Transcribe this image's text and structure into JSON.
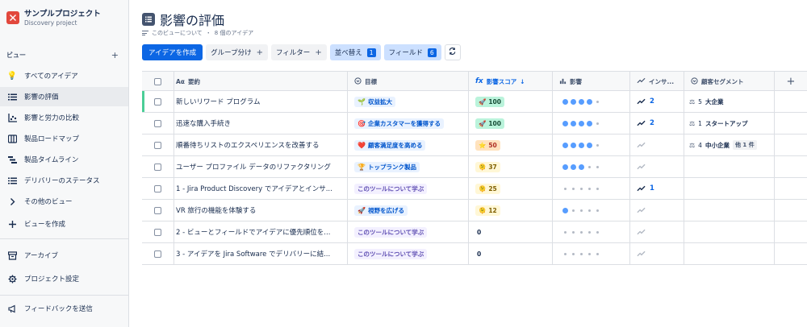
{
  "project": {
    "name": "サンプルプロジェクト",
    "subtitle": "Discovery project"
  },
  "sidebar": {
    "views_label": "ビュー",
    "items": [
      {
        "label": "すべてのアイデア",
        "icon": "lightbulb-icon"
      },
      {
        "label": "影響の評価",
        "icon": "list-icon",
        "active": true
      },
      {
        "label": "影響と労力の比較",
        "icon": "scatter-chart-icon"
      },
      {
        "label": "製品ロードマップ",
        "icon": "board-icon"
      },
      {
        "label": "製品タイムライン",
        "icon": "timeline-icon"
      },
      {
        "label": "デリバリーのステータス",
        "icon": "list-icon"
      },
      {
        "label": "その他のビュー",
        "icon": "chevron-right-icon"
      },
      {
        "label": "ビューを作成",
        "icon": "plus-icon"
      }
    ],
    "archive_label": "アーカイブ",
    "settings_label": "プロジェクト設定",
    "feedback_label": "フィードバックを送信"
  },
  "header": {
    "title": "影響の評価",
    "about": "このビューについて",
    "count": "8 個のアイデア",
    "separator": "・"
  },
  "toolbar": {
    "create_label": "アイデアを作成",
    "group_label": "グループ分け",
    "filter_label": "フィルター",
    "sort_label": "並べ替え",
    "sort_count": "1",
    "fields_label": "フィールド",
    "fields_count": "6"
  },
  "table": {
    "columns": {
      "summary": "要約",
      "summary_icon": "Aα",
      "goal": "目標",
      "score": "影響スコア",
      "score_icon": "fx",
      "impact": "影響",
      "insights": "インサ...",
      "segment": "顧客セグメント"
    },
    "rows": [
      {
        "summary": "新しいリワード プログラム",
        "goal": "収益拡大",
        "goal_emoji": "🌱",
        "goal_style": "goal",
        "score": "100",
        "score_emoji": "🚀",
        "score_style": "green",
        "impact": 4,
        "insights": "2",
        "segment_count": "5",
        "segment": "大企業",
        "segment_more": "",
        "highlight": true
      },
      {
        "summary": "迅速な購入手続き",
        "goal": "企業カスタマーを獲得する",
        "goal_emoji": "🎯",
        "goal_style": "goal",
        "score": "100",
        "score_emoji": "🚀",
        "score_style": "green",
        "impact": 4,
        "insights": "2",
        "segment_count": "1",
        "segment": "スタートアップ",
        "segment_more": "",
        "highlight": false
      },
      {
        "summary": "順番待ちリストのエクスペリエンスを改善する",
        "goal": "顧客満足度を高める",
        "goal_emoji": "❤️",
        "goal_style": "goal",
        "score": "50",
        "score_emoji": "⭐",
        "score_style": "red",
        "impact": 4,
        "insights": "",
        "segment_count": "4",
        "segment": "中小企業",
        "segment_more": "他 1 件",
        "highlight": false
      },
      {
        "summary": "ユーザー プロファイル データのリファクタリング",
        "goal": "トップランク製品",
        "goal_emoji": "🏆",
        "goal_style": "goal",
        "score": "37",
        "score_emoji": "🫠",
        "score_style": "amber",
        "impact": 3,
        "insights": "",
        "segment_count": "",
        "segment": "",
        "segment_more": "",
        "highlight": false
      },
      {
        "summary": "1 - Jira Product Discovery でアイデアとインサ...",
        "goal": "このツールについて学ぶ",
        "goal_emoji": "",
        "goal_style": "learn",
        "score": "25",
        "score_emoji": "🫠",
        "score_style": "amber",
        "impact": 0,
        "insights": "1",
        "segment_count": "",
        "segment": "",
        "segment_more": "",
        "highlight": false
      },
      {
        "summary": "VR 旅行の機能を体験する",
        "goal": "視野を広げる",
        "goal_emoji": "🚀",
        "goal_style": "goal",
        "score": "12",
        "score_emoji": "🫠",
        "score_style": "amber",
        "impact": 1,
        "insights": "",
        "segment_count": "",
        "segment": "",
        "segment_more": "",
        "highlight": false
      },
      {
        "summary": "2 - ビューとフィールドでアイデアに優先順位を...",
        "goal": "このツールについて学ぶ",
        "goal_emoji": "",
        "goal_style": "learn",
        "score": "0",
        "score_emoji": "",
        "score_style": "plain",
        "impact": -1,
        "insights": "",
        "segment_count": "",
        "segment": "",
        "segment_more": "",
        "highlight": false
      },
      {
        "summary": "3 - アイデアを Jira Software でデリバリーに結...",
        "goal": "このツールについて学ぶ",
        "goal_emoji": "",
        "goal_style": "learn",
        "score": "0",
        "score_emoji": "",
        "score_style": "plain",
        "impact": -1,
        "insights": "",
        "segment_count": "",
        "segment": "",
        "segment_more": "",
        "highlight": false
      }
    ]
  }
}
